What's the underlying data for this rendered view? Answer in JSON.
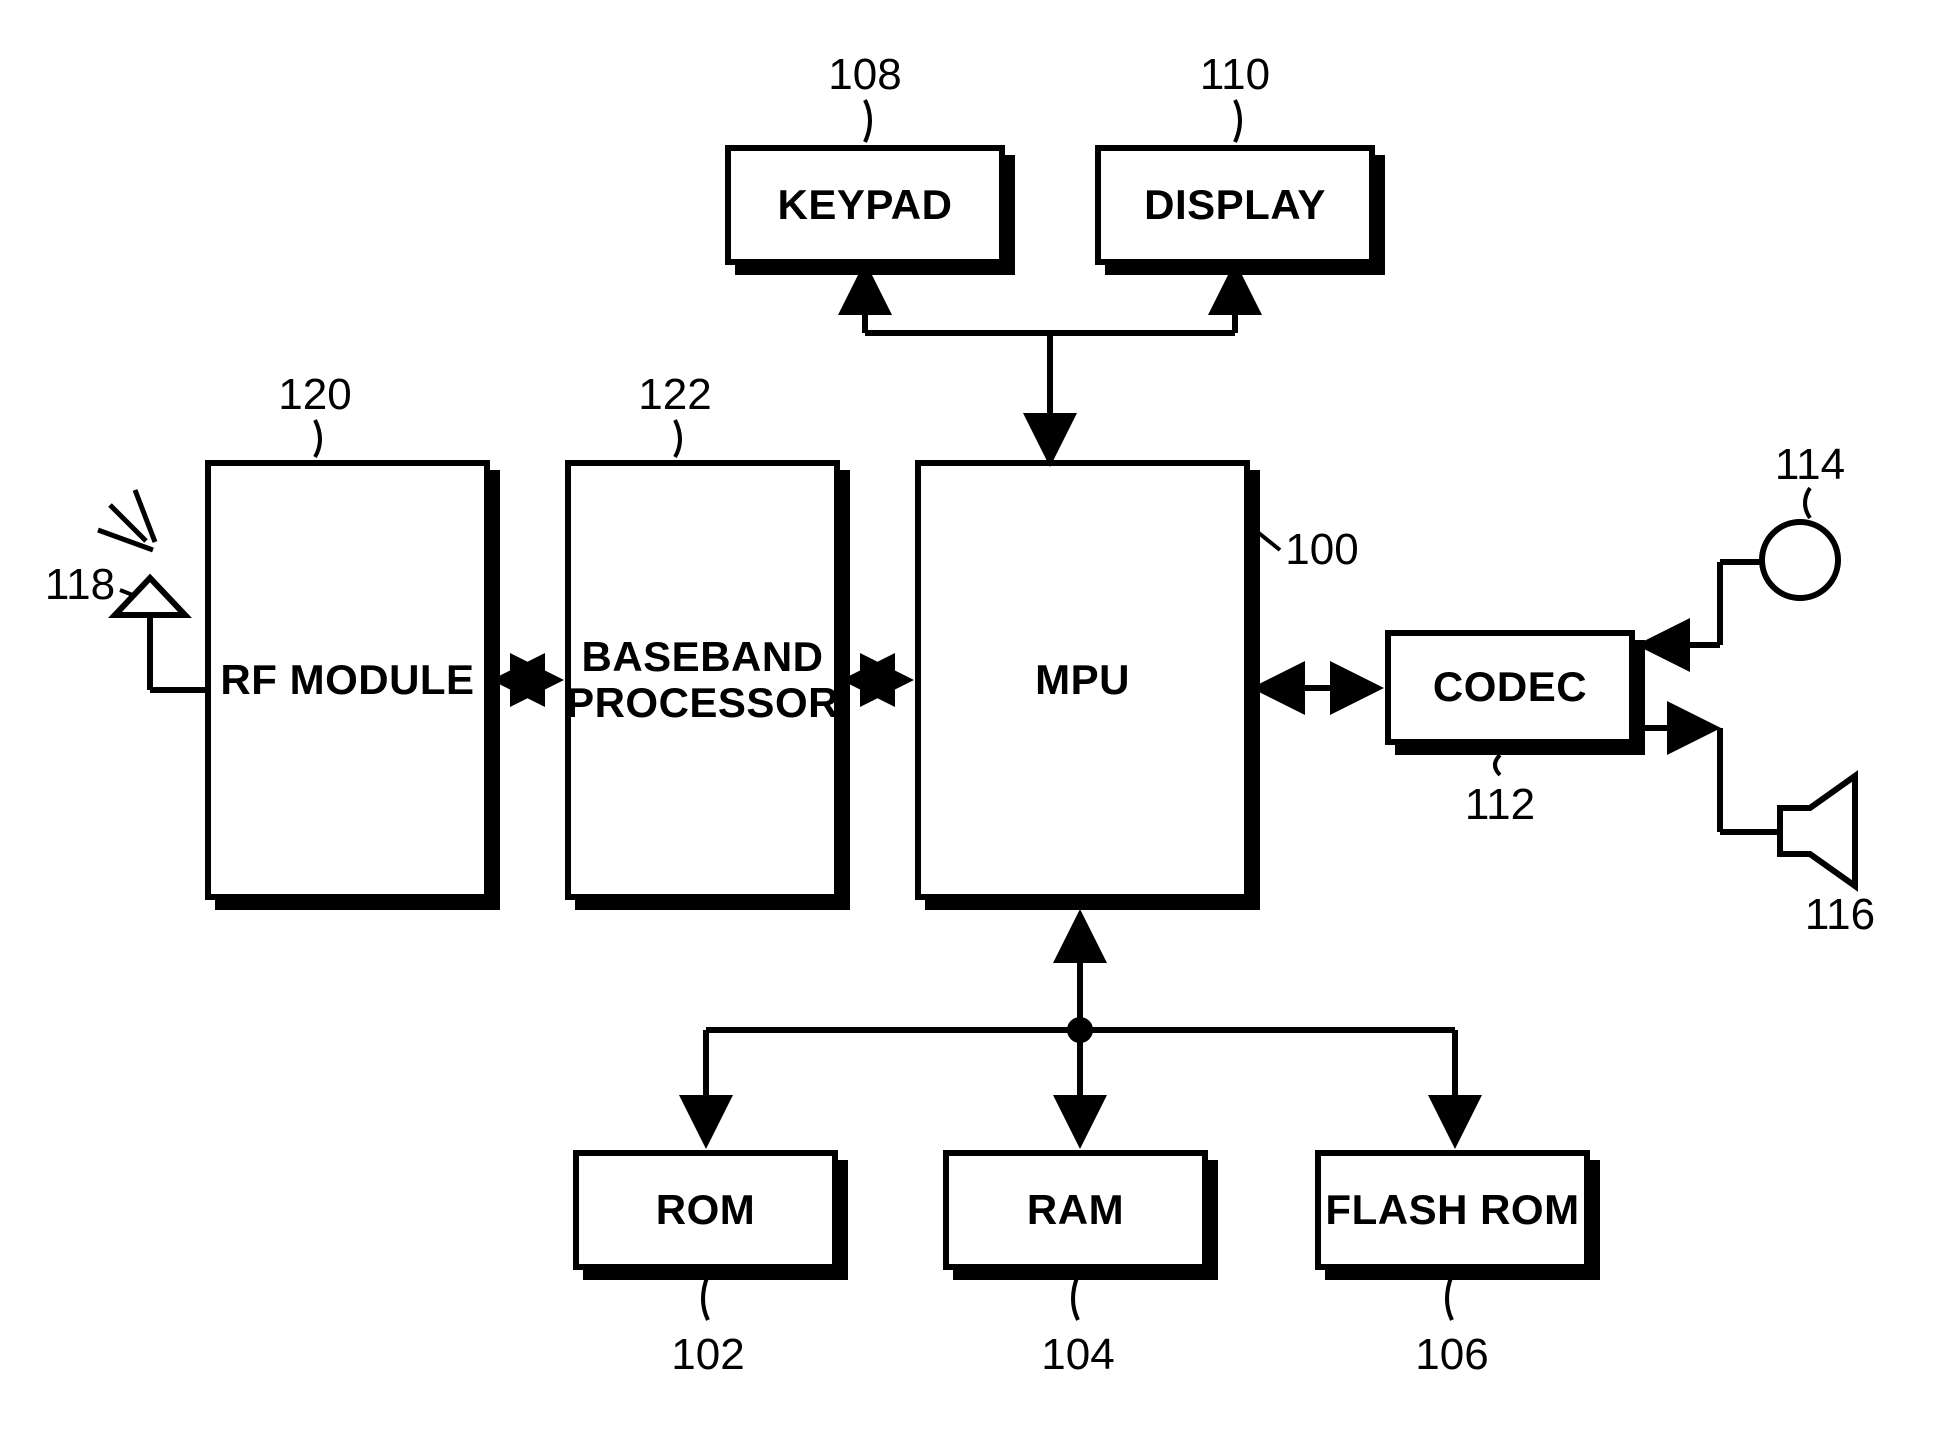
{
  "diagram": {
    "blocks": {
      "keypad": {
        "label": "KEYPAD",
        "ref": "108"
      },
      "display": {
        "label": "DISPLAY",
        "ref": "110"
      },
      "rf": {
        "label": "RF MODULE",
        "ref": "120"
      },
      "baseband": {
        "label": "BASEBAND\nPROCESSOR",
        "ref": "122"
      },
      "mpu": {
        "label": "MPU",
        "ref": "100"
      },
      "codec": {
        "label": "CODEC",
        "ref": "112"
      },
      "rom": {
        "label": "ROM",
        "ref": "102"
      },
      "ram": {
        "label": "RAM",
        "ref": "104"
      },
      "flash": {
        "label": "FLASH ROM",
        "ref": "106"
      },
      "antenna": {
        "ref": "118"
      },
      "mic": {
        "ref": "114"
      },
      "speaker": {
        "ref": "116"
      }
    }
  }
}
